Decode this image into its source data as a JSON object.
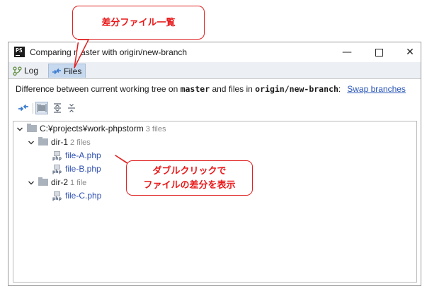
{
  "window": {
    "title": "Comparing master with origin/new-branch",
    "controls": {
      "minimize": "—",
      "maximize": "",
      "close": "✕"
    }
  },
  "tabs": [
    {
      "label": "Log",
      "icon": "vcs-log-icon",
      "active": false
    },
    {
      "label": "Files",
      "icon": "compare-files-icon",
      "active": true
    }
  ],
  "description": {
    "prefix": "Difference between current working tree on ",
    "branch_local": "master",
    "middle": " and files in ",
    "branch_remote": "origin/new-branch",
    "suffix": ":",
    "swap_link": "Swap branches"
  },
  "toolbar": {
    "buttons": [
      "show-diff-icon",
      "group-by-directory-icon",
      "expand-all-icon",
      "collapse-all-icon"
    ]
  },
  "tree": {
    "root": {
      "label": "C:¥projects¥work-phpstorm",
      "count": "3 files"
    },
    "dirs": [
      {
        "label": "dir-1",
        "count": "2 files",
        "files": [
          "file-A.php",
          "file-B.php"
        ]
      },
      {
        "label": "dir-2",
        "count": "1 file",
        "files": [
          "file-C.php"
        ]
      }
    ]
  },
  "annotations": {
    "top": "差分ファイル一覧",
    "mid_line1": "ダブルクリックで",
    "mid_line2": "ファイルの差分を表示"
  },
  "colors": {
    "accent_red": "#e8191a",
    "link_blue": "#2a55b8",
    "file_blue": "#2e4fb1",
    "tab_active": "#c7d9ee"
  }
}
